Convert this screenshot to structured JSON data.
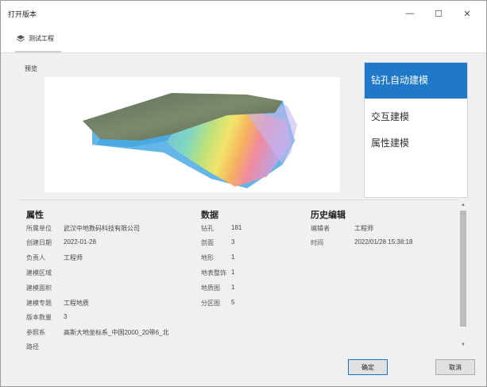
{
  "window": {
    "title": "打开版本"
  },
  "toolbar": {
    "project_name": "测试工程"
  },
  "preview": {
    "label": "预览"
  },
  "modes": [
    {
      "label": "钻孔自动建模",
      "active": true
    },
    {
      "label": "交互建模",
      "active": false
    },
    {
      "label": "属性建模",
      "active": false
    }
  ],
  "attributes": {
    "heading": "属性",
    "rows": [
      {
        "label": "所属单位",
        "value": "武汉中地数码科技有限公司"
      },
      {
        "label": "创建日期",
        "value": "2022-01-28"
      },
      {
        "label": "负责人",
        "value": "工程师"
      },
      {
        "label": "建模区域",
        "value": ""
      },
      {
        "label": "建模面积",
        "value": ""
      },
      {
        "label": "建模专题",
        "value": "工程地质"
      },
      {
        "label": "版本数量",
        "value": "3"
      },
      {
        "label": "参照系",
        "value": "高斯大地坐标系_中国2000_20带6_北"
      },
      {
        "label": "路径",
        "value": ""
      }
    ]
  },
  "data": {
    "heading": "数据",
    "rows": [
      {
        "label": "钻孔",
        "value": "181"
      },
      {
        "label": "剖面",
        "value": "3"
      },
      {
        "label": "地形",
        "value": "1"
      },
      {
        "label": "地表整饰",
        "value": "1"
      },
      {
        "label": "地质图",
        "value": "1"
      },
      {
        "label": "分区图",
        "value": "5"
      }
    ]
  },
  "history": {
    "heading": "历史编辑",
    "rows": [
      {
        "label": "编辑者",
        "value": "工程师"
      },
      {
        "label": "时间",
        "value": "2022/01/28 15:38:18"
      }
    ]
  },
  "buttons": {
    "ok": "确定",
    "cancel": "取消"
  },
  "colors": {
    "accent": "#1f78c8"
  }
}
